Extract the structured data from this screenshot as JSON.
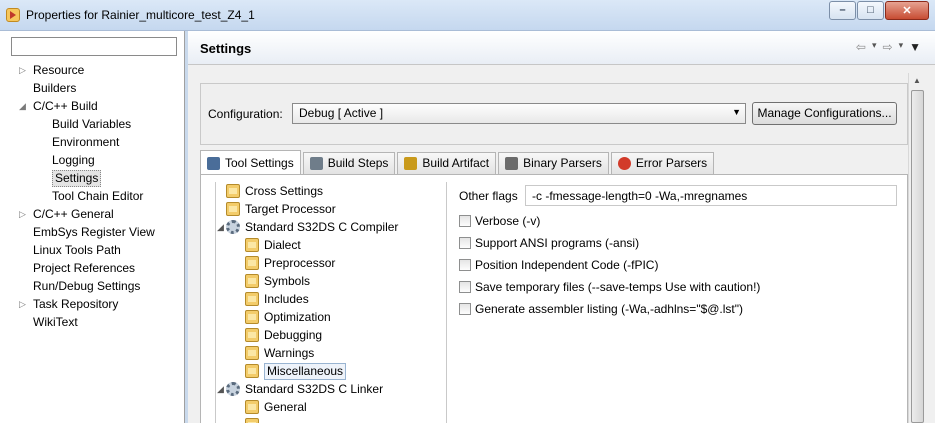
{
  "window": {
    "title": "Properties for Rainier_multicore_test_Z4_1",
    "minimize": "–",
    "maximize": "□",
    "close": "✕"
  },
  "sidebar": {
    "filter_value": "",
    "items": [
      {
        "label": "Resource",
        "expander": "▷",
        "level": 0
      },
      {
        "label": "Builders",
        "expander": "",
        "level": 0
      },
      {
        "label": "C/C++ Build",
        "expander": "◢",
        "level": 0
      },
      {
        "label": "Build Variables",
        "expander": "",
        "level": 1
      },
      {
        "label": "Environment",
        "expander": "",
        "level": 1
      },
      {
        "label": "Logging",
        "expander": "",
        "level": 1
      },
      {
        "label": "Settings",
        "expander": "",
        "level": 1,
        "selected": true
      },
      {
        "label": "Tool Chain Editor",
        "expander": "",
        "level": 1
      },
      {
        "label": "C/C++ General",
        "expander": "▷",
        "level": 0
      },
      {
        "label": "EmbSys Register View",
        "expander": "",
        "level": 0
      },
      {
        "label": "Linux Tools Path",
        "expander": "",
        "level": 0
      },
      {
        "label": "Project References",
        "expander": "",
        "level": 0
      },
      {
        "label": "Run/Debug Settings",
        "expander": "",
        "level": 0
      },
      {
        "label": "Task Repository",
        "expander": "▷",
        "level": 0
      },
      {
        "label": "WikiText",
        "expander": "",
        "level": 0
      }
    ]
  },
  "header": {
    "title": "Settings",
    "back_icon": "⇦",
    "forward_icon": "⇨",
    "dropdown_icon": "▾",
    "menu_icon": "▼"
  },
  "configuration": {
    "label": "Configuration:",
    "value": "Debug  [ Active ]",
    "manage_button": "Manage Configurations..."
  },
  "tabs": [
    {
      "label": "Tool Settings",
      "icon": "tool-settings-icon",
      "active": true
    },
    {
      "label": "Build Steps",
      "icon": "build-steps-icon"
    },
    {
      "label": "Build Artifact",
      "icon": "build-artifact-icon"
    },
    {
      "label": "Binary Parsers",
      "icon": "binary-parsers-icon"
    },
    {
      "label": "Error Parsers",
      "icon": "error-parsers-icon"
    }
  ],
  "tool_tree": [
    {
      "label": "Cross Settings",
      "level": 1,
      "icon": "folder"
    },
    {
      "label": "Target Processor",
      "level": 1,
      "icon": "folder"
    },
    {
      "label": "Standard S32DS C Compiler",
      "level": 0,
      "icon": "gear",
      "expander": "◢"
    },
    {
      "label": "Dialect",
      "level": 2,
      "icon": "folder"
    },
    {
      "label": "Preprocessor",
      "level": 2,
      "icon": "folder"
    },
    {
      "label": "Symbols",
      "level": 2,
      "icon": "folder"
    },
    {
      "label": "Includes",
      "level": 2,
      "icon": "folder"
    },
    {
      "label": "Optimization",
      "level": 2,
      "icon": "folder"
    },
    {
      "label": "Debugging",
      "level": 2,
      "icon": "folder"
    },
    {
      "label": "Warnings",
      "level": 2,
      "icon": "folder"
    },
    {
      "label": "Miscellaneous",
      "level": 2,
      "icon": "folder",
      "selected": true
    },
    {
      "label": "Standard S32DS C Linker",
      "level": 0,
      "icon": "gear",
      "expander": "◢"
    },
    {
      "label": "General",
      "level": 2,
      "icon": "folder"
    },
    {
      "label": "",
      "level": 2,
      "icon": "folder"
    }
  ],
  "misc": {
    "other_flags_label": "Other flags",
    "other_flags_value": "-c -fmessage-length=0 -Wa,-mregnames",
    "options": [
      {
        "label": "Verbose (-v)",
        "checked": false
      },
      {
        "label": "Support ANSI programs (-ansi)",
        "checked": false
      },
      {
        "label": "Position Independent Code (-fPIC)",
        "checked": false
      },
      {
        "label": "Save temporary files (--save-temps Use with caution!)",
        "checked": false
      },
      {
        "label": "Generate assembler listing (-Wa,-adhlns=\"$@.lst\")",
        "checked": false
      }
    ]
  },
  "scrollbar": {
    "up_icon": "▲"
  }
}
